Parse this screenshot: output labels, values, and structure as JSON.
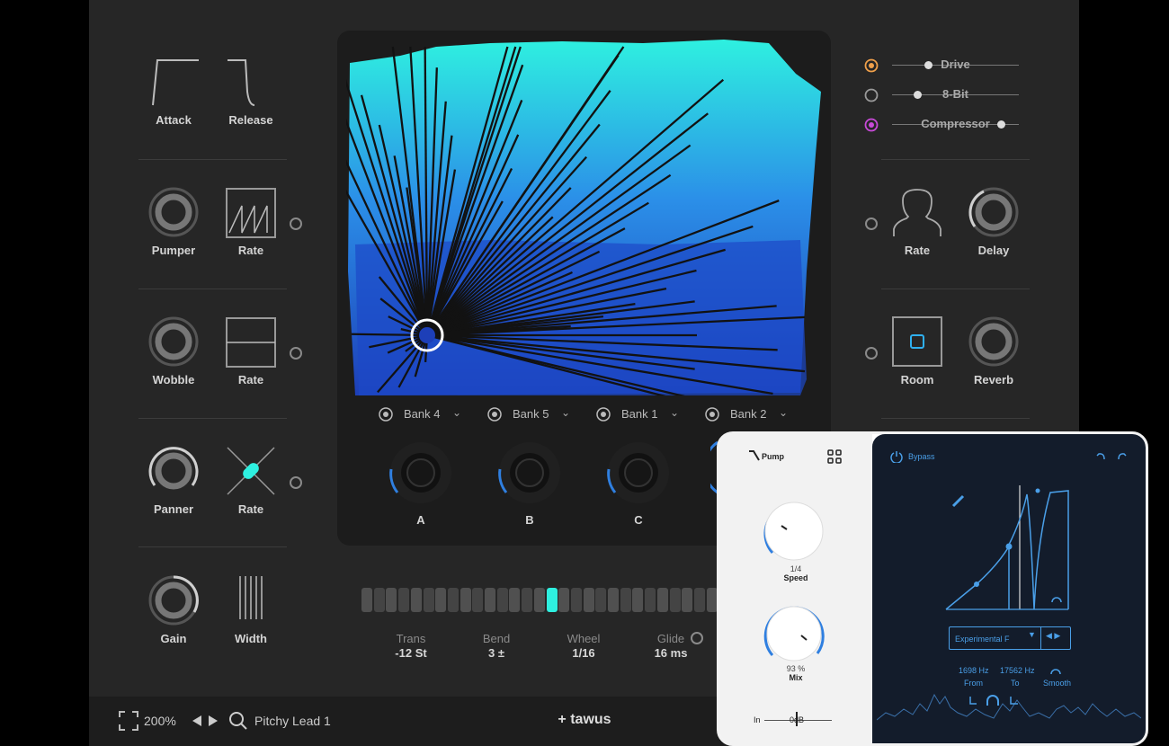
{
  "left_panel": {
    "envelope": {
      "attack_label": "Attack",
      "release_label": "Release"
    },
    "rows": [
      {
        "knob_label": "Pumper",
        "rate_label": "Rate"
      },
      {
        "knob_label": "Wobble",
        "rate_label": "Rate"
      },
      {
        "knob_label": "Panner",
        "rate_label": "Rate"
      },
      {
        "knob_label": "Gain",
        "rate_label": "Width"
      }
    ]
  },
  "banks": [
    {
      "label": "Bank 4"
    },
    {
      "label": "Bank 5"
    },
    {
      "label": "Bank 1"
    },
    {
      "label": "Bank 2"
    }
  ],
  "macros": [
    {
      "label": "A"
    },
    {
      "label": "B"
    },
    {
      "label": "C"
    }
  ],
  "sequencer": {
    "step_count": 29,
    "active_step": 15
  },
  "params": [
    {
      "label": "Trans",
      "value": "-12 St"
    },
    {
      "label": "Bend",
      "value": "3 ±"
    },
    {
      "label": "Wheel",
      "value": "1/16"
    },
    {
      "label": "Glide",
      "value": "16 ms"
    }
  ],
  "effects": [
    {
      "label": "Drive",
      "color": "#f0a04a",
      "active": true
    },
    {
      "label": "8-Bit",
      "color": "#9a9a9a",
      "active": false
    },
    {
      "label": "Compressor",
      "color": "#c84ad8",
      "active": true
    }
  ],
  "right_panel": {
    "row1": {
      "left_label": "Rate",
      "right_label": "Delay"
    },
    "row2": {
      "left_label": "Room",
      "right_label": "Reverb"
    }
  },
  "footer": {
    "zoom": "200%",
    "preset": "Pitchy Lead 1",
    "brand": "+ tawus"
  },
  "pump_plugin": {
    "title": "Pump",
    "speed_value": "1/4",
    "speed_label": "Speed",
    "mix_value": "93 %",
    "mix_label": "Mix",
    "input_label": "In",
    "input_value": "0dB",
    "bypass_label": "Bypass",
    "preset_name": "Experimental F",
    "from_value": "1698 Hz",
    "from_label": "From",
    "to_value": "17562 Hz",
    "to_label": "To",
    "smooth_label": "Smooth"
  },
  "colors": {
    "accent_cyan": "#2ef0e0",
    "accent_blue": "#2f7fe0",
    "bg_panel": "#262626"
  }
}
